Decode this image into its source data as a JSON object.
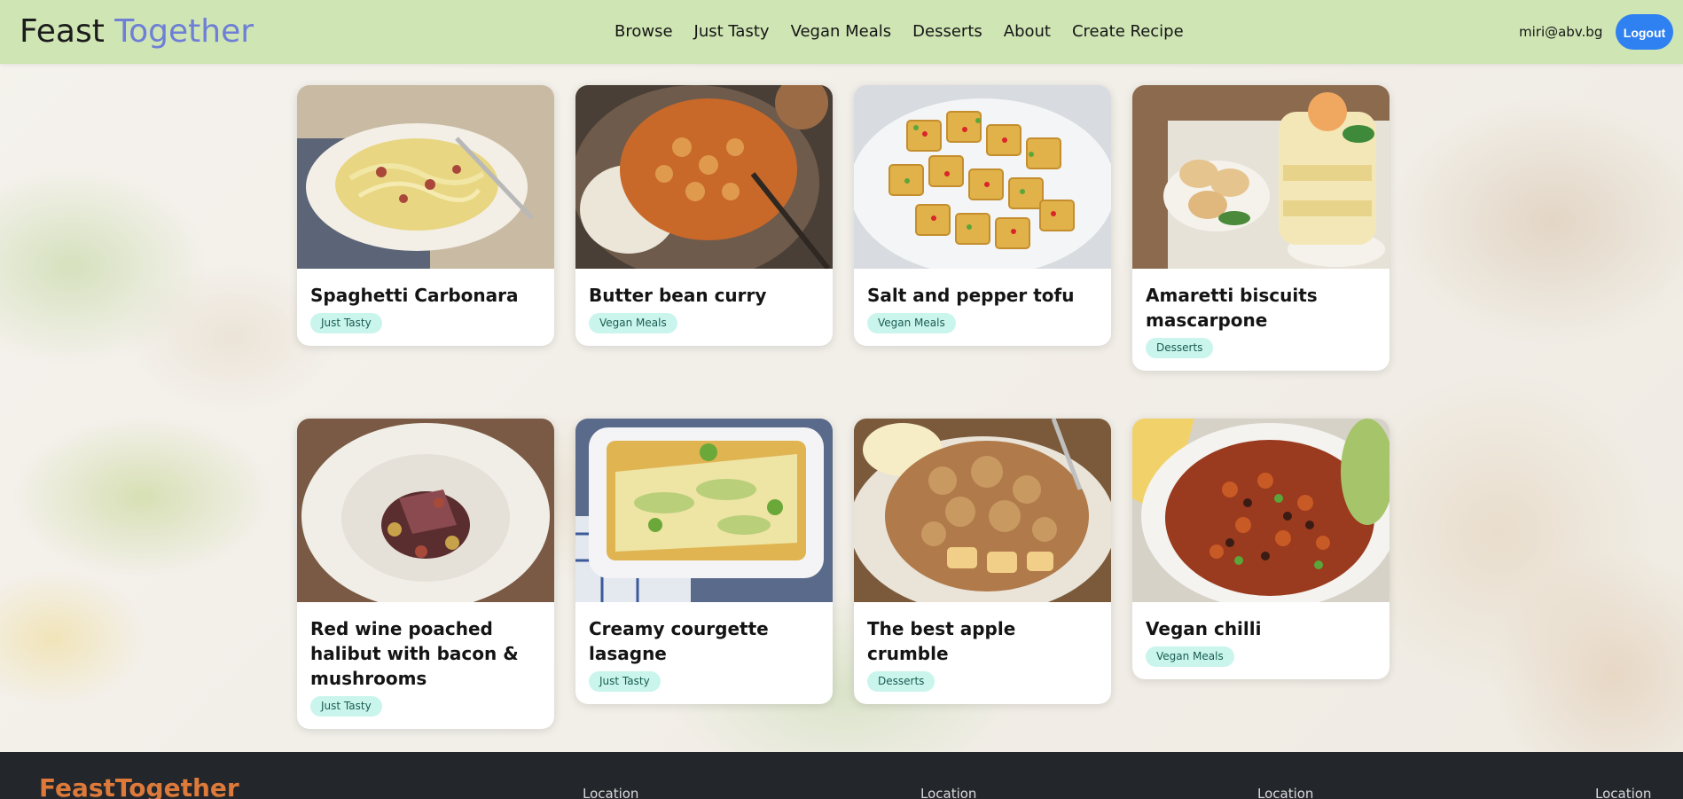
{
  "header": {
    "brand_part1": "Feast",
    "brand_part2": "Together",
    "nav": [
      "Browse",
      "Just Tasty",
      "Vegan Meals",
      "Desserts",
      "About",
      "Create Recipe"
    ],
    "user_email": "miri@abv.bg",
    "logout_label": "Logout"
  },
  "recipes": [
    {
      "title": "Spaghetti Carbonara",
      "category": "Just Tasty",
      "image": "spaghetti-carbonara-photo"
    },
    {
      "title": "Butter bean curry",
      "category": "Vegan Meals",
      "image": "butter-bean-curry-photo"
    },
    {
      "title": "Salt and pepper tofu",
      "category": "Vegan Meals",
      "image": "salt-pepper-tofu-photo"
    },
    {
      "title": "Amaretti biscuits mascarpone",
      "category": "Desserts",
      "image": "amaretti-mascarpone-photo"
    },
    {
      "title": "Red wine poached halibut with bacon & mushrooms",
      "category": "Just Tasty",
      "image": "halibut-photo"
    },
    {
      "title": "Creamy courgette lasagne",
      "category": "Just Tasty",
      "image": "courgette-lasagne-photo"
    },
    {
      "title": "The best apple crumble",
      "category": "Desserts",
      "image": "apple-crumble-photo"
    },
    {
      "title": "Vegan chilli",
      "category": "Vegan Meals",
      "image": "vegan-chilli-photo"
    }
  ],
  "footer": {
    "brand": "FeastTogether",
    "columns": [
      "Location",
      "Location",
      "Location",
      "Location"
    ]
  },
  "colors": {
    "header_bg": "#cfe5b4",
    "brand_accent": "#6d7fd6",
    "logout_bg": "#2f80f0",
    "badge_bg": "#c9f5ec",
    "footer_bg": "#23262b",
    "footer_brand": "#dd7a3a"
  }
}
